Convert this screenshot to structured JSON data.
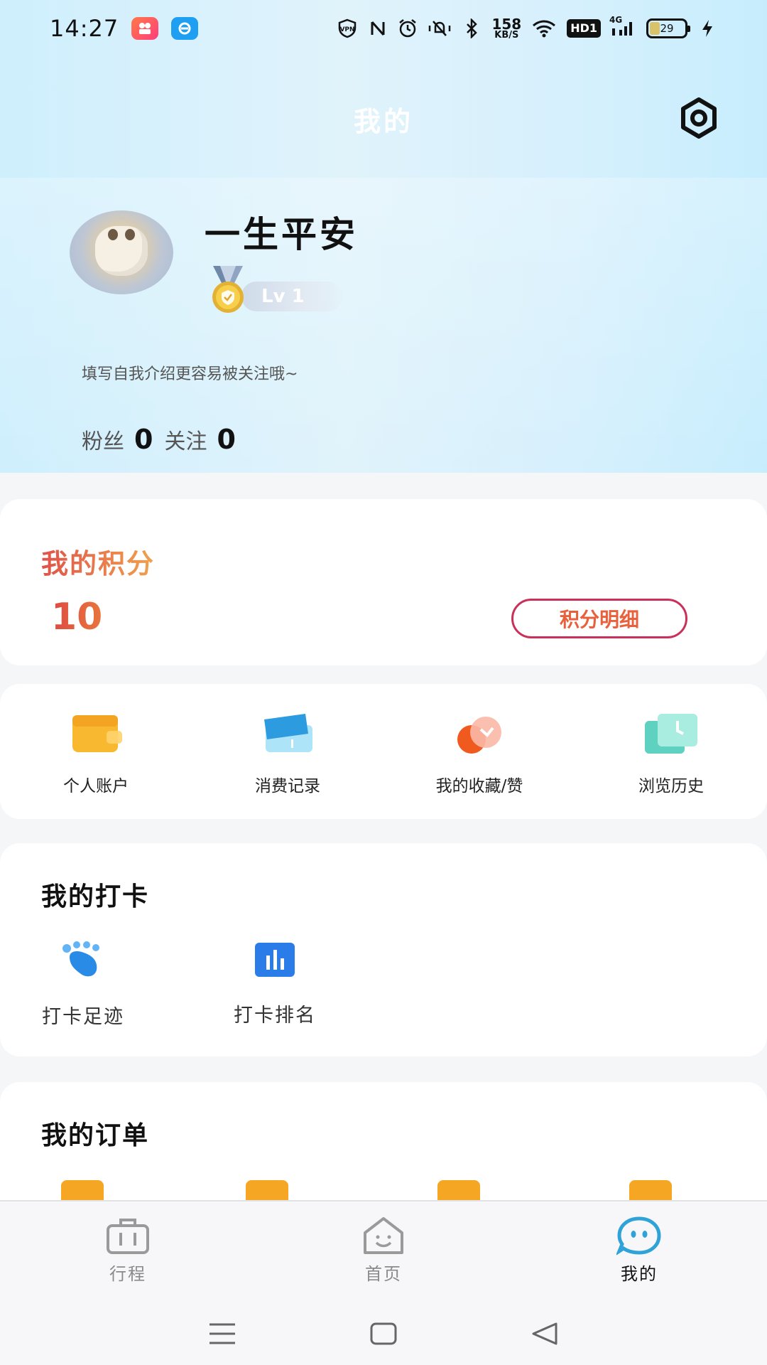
{
  "status_bar": {
    "time": "14:27",
    "app_icons": [
      "kuaishou-app-icon",
      "eleme-app-icon"
    ],
    "net_speed_value": "158",
    "net_speed_unit": "KB/S",
    "hd_badge": "HD1",
    "network": "4G",
    "battery_level": "29"
  },
  "header": {
    "title": "我的",
    "settings_icon": "settings-hexagon-icon"
  },
  "profile": {
    "username": "一生平安",
    "level": "Lv 1",
    "bio": "填写自我介绍更容易被关注哦~",
    "fans_label": "粉丝",
    "fans_count": "0",
    "following_label": "关注",
    "following_count": "0"
  },
  "points": {
    "title": "我的积分",
    "value": "10",
    "detail_button": "积分明细"
  },
  "shortcuts": [
    {
      "label": "个人账户",
      "icon": "wallet-icon"
    },
    {
      "label": "消费记录",
      "icon": "card-icon"
    },
    {
      "label": "我的收藏/赞",
      "icon": "favorite-icon"
    },
    {
      "label": "浏览历史",
      "icon": "history-icon"
    }
  ],
  "checkin": {
    "title": "我的打卡",
    "items": [
      {
        "label": "打卡足迹",
        "icon": "footprint-icon"
      },
      {
        "label": "打卡排名",
        "icon": "ranking-icon"
      }
    ]
  },
  "orders": {
    "title": "我的订单"
  },
  "bottom_nav": {
    "items": [
      {
        "label": "行程",
        "icon": "suitcase-icon"
      },
      {
        "label": "首页",
        "icon": "home-icon"
      },
      {
        "label": "我的",
        "icon": "mine-face-icon"
      }
    ],
    "active": "我的"
  },
  "colors": {
    "accent_blue": "#2fa3d8",
    "points_gradient_start": "#e0524a",
    "points_gradient_end": "#f0a24d",
    "detail_button_border": "#c9305a"
  }
}
